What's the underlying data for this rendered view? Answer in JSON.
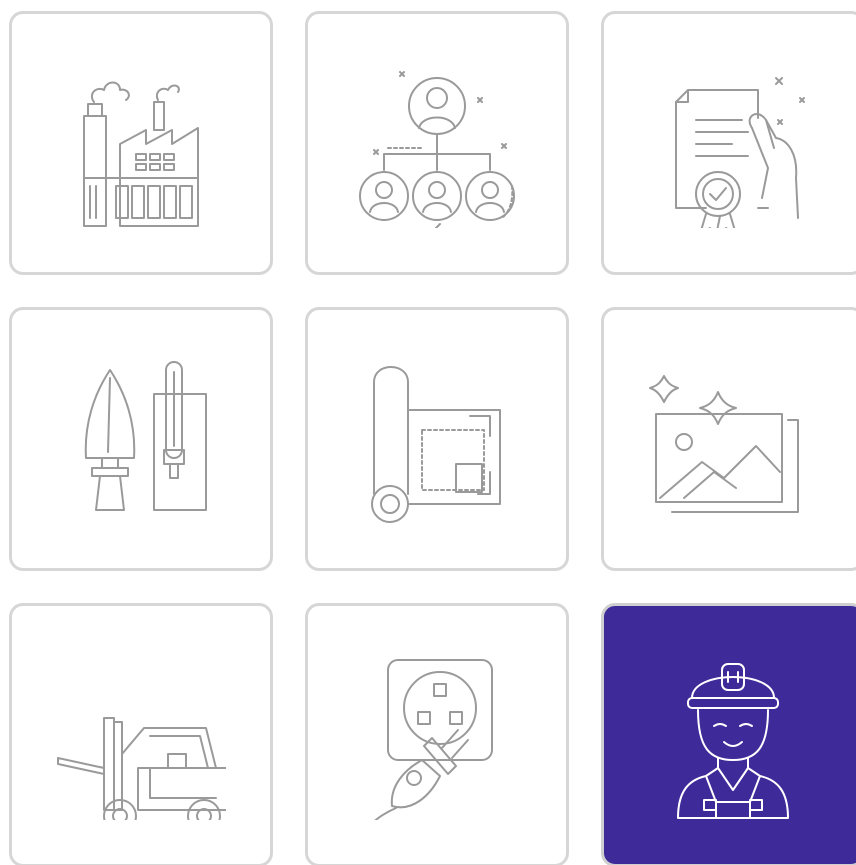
{
  "colors": {
    "tile_border": "#d6d6d6",
    "icon_stroke": "#9a9a9a",
    "selected_background": "#3f2a9a",
    "selected_icon": "#ffffff"
  },
  "tiles": [
    {
      "icon": "factory-icon",
      "selected": false
    },
    {
      "icon": "team-hierarchy-icon",
      "selected": false
    },
    {
      "icon": "certificate-icon",
      "selected": false
    },
    {
      "icon": "trowel-tools-icon",
      "selected": false
    },
    {
      "icon": "blueprint-icon",
      "selected": false
    },
    {
      "icon": "image-gallery-icon",
      "selected": false
    },
    {
      "icon": "forklift-icon",
      "selected": false
    },
    {
      "icon": "power-plug-icon",
      "selected": false
    },
    {
      "icon": "construction-worker-icon",
      "selected": true
    }
  ]
}
